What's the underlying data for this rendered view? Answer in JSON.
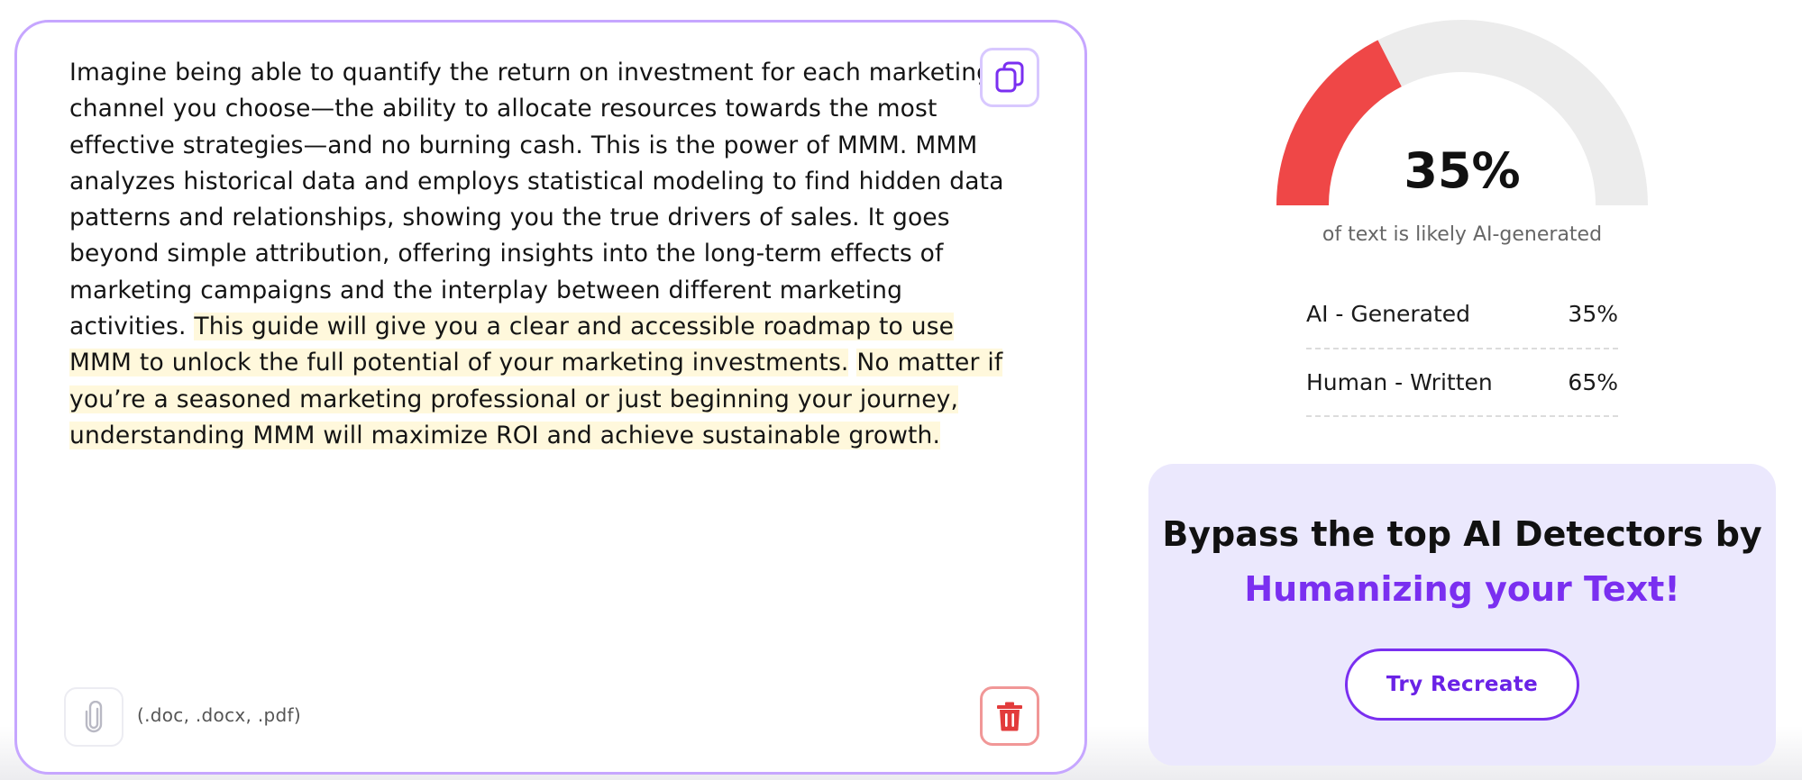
{
  "editor": {
    "paragraph_plain": "Imagine being able to quantify the return on investment for each marketing channel you choose—the ability to allocate resources towards the most effective strategies—and no burning cash. This is the power of MMM. MMM analyzes historical data and employs statistical modeling to find hidden data patterns and relationships, showing you the true drivers of sales. It goes beyond simple attribution, offering insights into the long-term effects of marketing campaigns and the interplay between different marketing activities.",
    "highlight_1": "This guide will give you a clear and accessible roadmap to use MMM to unlock the full potential of your marketing investments.",
    "highlight_2": "No matter if you’re a seasoned marketing professional or just beginning your journey, understanding MMM will maximize ROI and achieve sustainable growth.",
    "file_formats": "(.doc, .docx, .pdf)",
    "copy_icon": "copy-icon",
    "attach_icon": "paperclip-icon",
    "delete_icon": "trash-icon",
    "highlight_color": "#fff8dc",
    "border_color": "#c6a6ff"
  },
  "result": {
    "percent_label": "35%",
    "ai_fraction": 0.35,
    "caption": "of text is likely AI-generated",
    "gauge_fill_color": "#ef4747",
    "gauge_track_color": "#ececec",
    "rows": [
      {
        "label": "AI - Generated",
        "value": "35%"
      },
      {
        "label": "Human - Written",
        "value": "65%"
      }
    ]
  },
  "promo": {
    "line1": "Bypass the top AI Detectors by",
    "line2": "Humanizing your Text!",
    "button_label": "Try Recreate",
    "accent_color": "#7a2ff0"
  }
}
